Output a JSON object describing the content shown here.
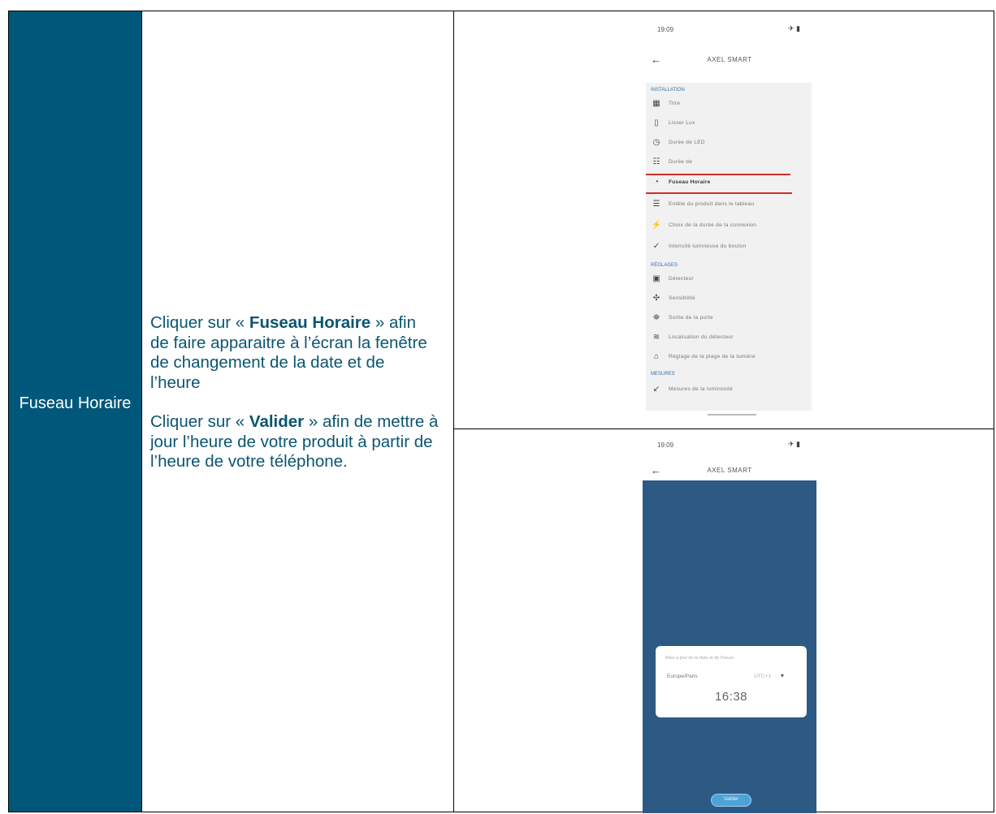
{
  "row": {
    "title": "Fuseau Horaire",
    "instruction1": {
      "pre": "Cliquer sur « ",
      "bold": "Fuseau Horaire",
      "post": " » afin de faire apparaitre à l’écran la fenêtre de changement de la date et de l’heure"
    },
    "instruction2": {
      "pre": "Cliquer sur « ",
      "bold": "Valider",
      "post": " » afin de mettre à jour l’heure de votre produit à partir de l’heure de votre téléphone."
    }
  },
  "phone1": {
    "status_time": "19:09",
    "status_icons": "✈ ▮",
    "app_title": "AXEL SMART",
    "menu_items": [
      "Titre",
      "Lisser Lux",
      "Durée de LED",
      "Durée de",
      "Fuseau Horaire",
      "Entête du produit dans le tableau",
      "Choix de la durée de la connexion",
      "Intensité lumineuse du bouton",
      "Détecteur",
      "Sensibilité",
      "Sortie de la porte",
      "Localisation du détecteur",
      "Réglage de la plage de la lumière",
      "Mesures de la luminosité"
    ],
    "section_headers": [
      "INSTALLATION",
      "RÉGLAGES",
      "MESURES"
    ]
  },
  "phone2": {
    "status_time": "19:09",
    "status_icons": "✈ ▮",
    "app_title": "AXEL SMART",
    "dialog_title": "Mise à jour de la date et de l'heure",
    "dialog_label": "Europe/Paris",
    "dialog_select": "UTC+1",
    "dialog_time": "16:38",
    "validate_label": "Valider"
  }
}
